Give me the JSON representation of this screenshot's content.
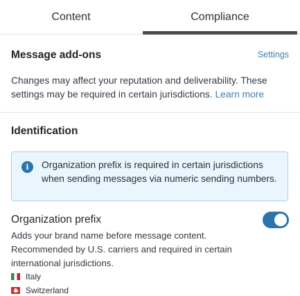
{
  "tabs": [
    {
      "label": "Content",
      "active": false
    },
    {
      "label": "Compliance",
      "active": true
    }
  ],
  "addons": {
    "title": "Message add-ons",
    "settings_link": "Settings",
    "description": "Changes may affect your reputation and deliverability. These settings may be required in certain jurisdictions.",
    "learn_more": "Learn more"
  },
  "identification": {
    "title": "Identification",
    "info_icon": "info-icon",
    "info_text": "Organization prefix is required in certain jurisdictions when sending messages via numeric sending numbers."
  },
  "org_prefix": {
    "title": "Organization prefix",
    "enabled": true,
    "description": "Adds your brand name before message content. Recommended by U.S. carriers and required in certain international jurisdictions.",
    "countries": [
      {
        "name": "Italy",
        "flag": "italy-flag-icon"
      },
      {
        "name": "Switzerland",
        "flag": "switzerland-flag-icon"
      }
    ]
  },
  "colors": {
    "accent": "#2d74ad",
    "link": "#3f7fb0",
    "info_bg": "#eaf6fd",
    "info_border": "#9fd2ef"
  }
}
